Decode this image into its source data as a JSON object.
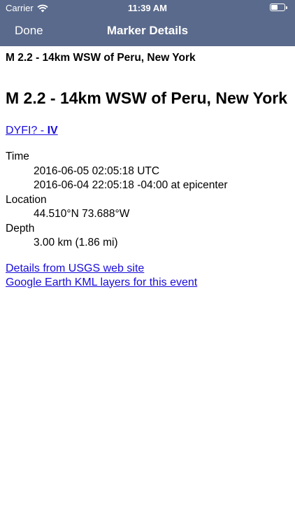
{
  "status_bar": {
    "carrier": "Carrier",
    "time": "11:39 AM"
  },
  "nav": {
    "done_label": "Done",
    "title": "Marker Details"
  },
  "event": {
    "small_title": "M 2.2 - 14km WSW of Peru, New York",
    "big_title": "M 2.2 - 14km WSW of Peru, New York",
    "dyfi_link_prefix": "DYFI? - ",
    "dyfi_intensity": "IV",
    "time_label": "Time",
    "time_utc": "2016-06-05 02:05:18 UTC",
    "time_local": "2016-06-04 22:05:18 -04:00 at epicenter",
    "location_label": "Location",
    "location_value": "44.510°N 73.688°W",
    "depth_label": "Depth",
    "depth_value": "3.00 km (1.86 mi)",
    "usgs_link": "Details from USGS web site",
    "kml_link": "Google Earth KML layers for this event"
  },
  "colors": {
    "nav_background": "#5a6a8c",
    "link": "#1a0ddb"
  }
}
